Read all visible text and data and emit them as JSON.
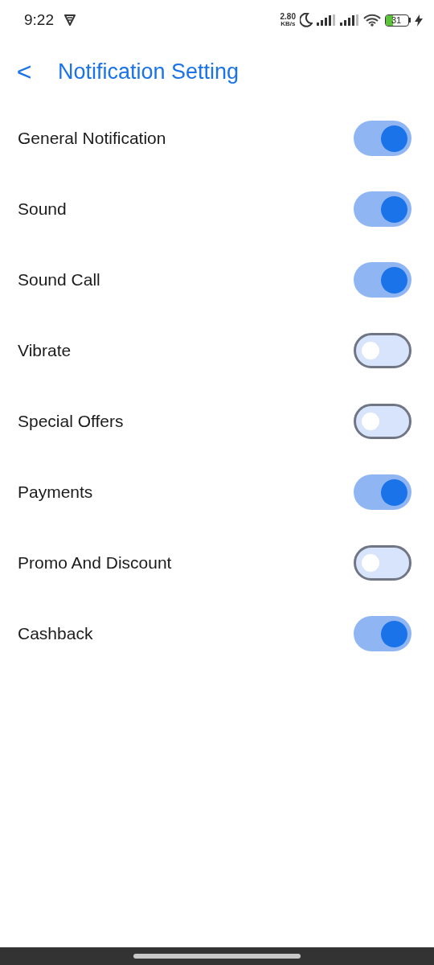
{
  "status_bar": {
    "time": "9:22",
    "speed_value": "2.80",
    "speed_unit": "KB/s",
    "battery": "31"
  },
  "header": {
    "back": "<",
    "title": "Notification Setting"
  },
  "settings": [
    {
      "label": "General Notification",
      "on": true
    },
    {
      "label": "Sound",
      "on": true
    },
    {
      "label": "Sound Call",
      "on": true
    },
    {
      "label": "Vibrate",
      "on": false
    },
    {
      "label": "Special Offers",
      "on": false
    },
    {
      "label": "Payments",
      "on": true
    },
    {
      "label": "Promo And Discount",
      "on": false
    },
    {
      "label": "Cashback",
      "on": true
    }
  ]
}
